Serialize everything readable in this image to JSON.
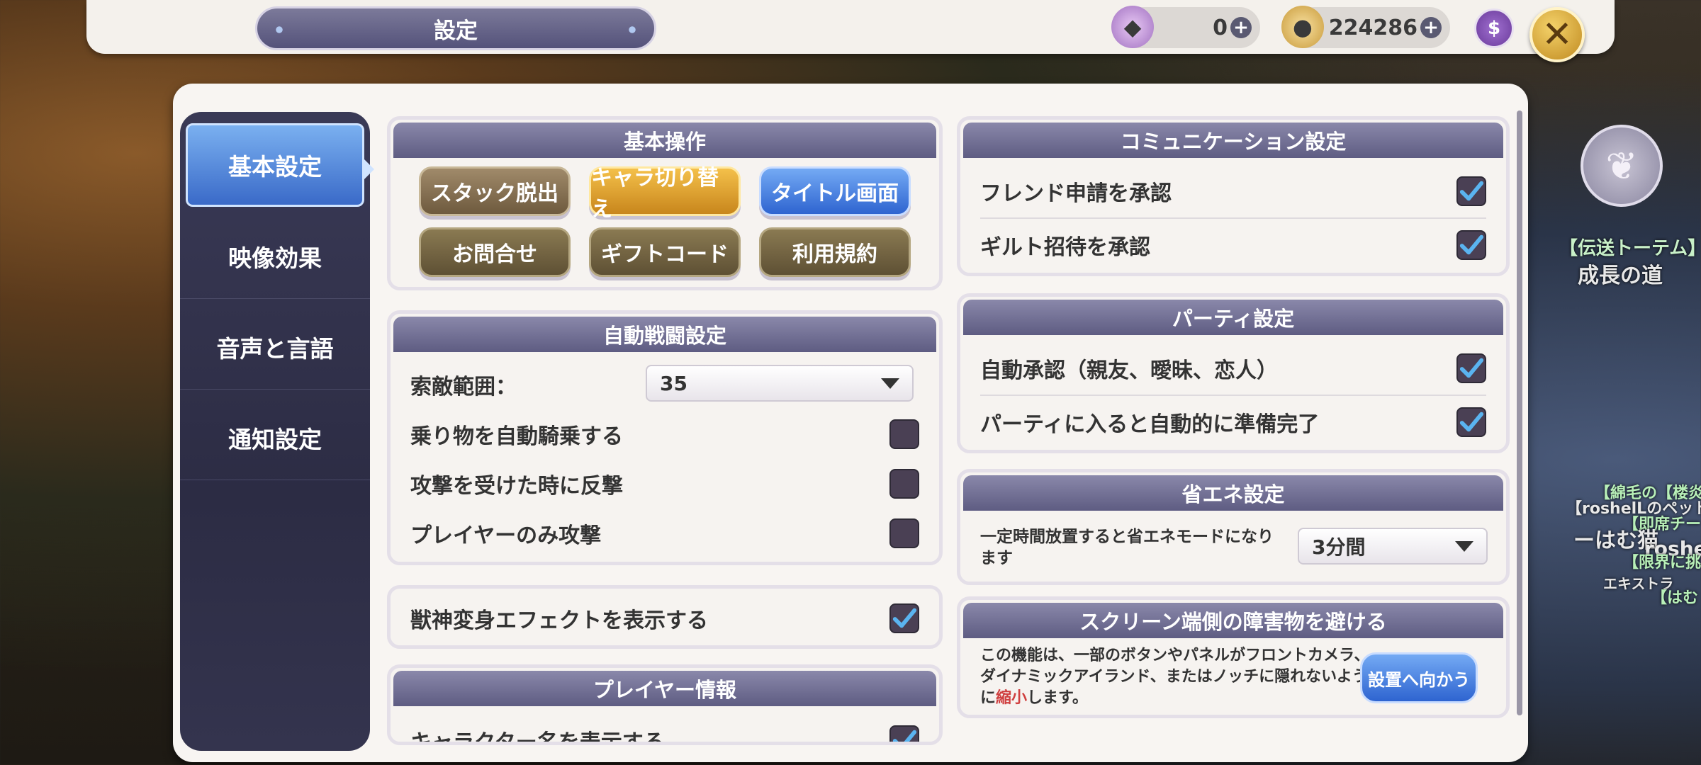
{
  "header": {
    "title": "設定",
    "gem_count": "0",
    "coin_count": "224286",
    "wallet_symbol": "$",
    "close_symbol": "✕"
  },
  "sidebar": {
    "tabs": [
      {
        "label": "基本設定"
      },
      {
        "label": "映像効果"
      },
      {
        "label": "音声と言語"
      },
      {
        "label": "通知設定"
      }
    ]
  },
  "basic_ops": {
    "title": "基本操作",
    "buttons": [
      "スタック脱出",
      "キャラ切り替え",
      "タイトル画面",
      "お問合せ",
      "ギフトコード",
      "利用規約"
    ]
  },
  "auto_battle": {
    "title": "自動戦闘設定",
    "range_label": "索敵範囲：",
    "range_value": "35",
    "mount_label": "乗り物を自動騎乗する",
    "mount_checked": false,
    "counter_label": "攻撃を受けた時に反撃",
    "counter_checked": false,
    "player_only_label": "プレイヤーのみ攻撃",
    "player_only_checked": false
  },
  "transform": {
    "label": "獣神変身エフェクトを表示する",
    "checked": true
  },
  "player_info": {
    "title": "プレイヤー情報",
    "char_name_label": "キャラクター名を表示する",
    "checked": true
  },
  "communication": {
    "title": "コミュニケーション設定",
    "friend_label": "フレンド申請を承認",
    "friend_checked": true,
    "guild_label": "ギルト招待を承認",
    "guild_checked": true
  },
  "party": {
    "title": "パーティ設定",
    "auto_accept_label": "自動承認（親友、曖昧、恋人）",
    "auto_accept_checked": true,
    "auto_ready_label": "パーティに入ると自動的に準備完了",
    "auto_ready_checked": true
  },
  "power_save": {
    "title": "省エネ設定",
    "description": "一定時間放置すると省エネモードになります",
    "value": "3分間"
  },
  "screen_edge": {
    "title": "スクリーン端側の障害物を避ける",
    "description_pre": "この機能は、一部のボタンやパネルがフロントカメラ、ダイナミックアイランド、またはノッチに隠れないように",
    "description_highlight": "縮小",
    "description_post": "します。",
    "button": "設置へ向かう"
  },
  "background": {
    "totem_label": "【伝送トーテム】",
    "totem_name": "成長の道",
    "chat_lines": [
      "【綿毛の【楼炎】",
      "【roshelLのペット】",
      "【即席チー",
      "ーはむ猫",
      "roshe",
      "【限界に挑",
      "エキストラ",
      "【はむ"
    ]
  },
  "colors": {
    "accent_blue": "#3a6ac8",
    "header_purple": "#5e5c82",
    "highlight_red": "#d04040"
  }
}
